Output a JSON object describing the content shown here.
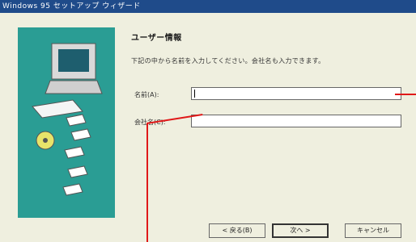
{
  "window": {
    "title": "Windows 95 セットアップ ウィザード"
  },
  "page": {
    "heading": "ユーザー情報",
    "description": "下記の中から名前を入力してください。会社名も入力できます。",
    "name_label": "名前(A):",
    "company_label": "会社名(C):",
    "name_value": "",
    "company_value": ""
  },
  "buttons": {
    "back": "< 戻る(B)",
    "next": "次へ >",
    "cancel": "キャンセル"
  },
  "colors": {
    "accent": "#e01919",
    "titlebar": "#1f4b8a",
    "illustration_bg": "#2a9d94",
    "dialog_bg": "#efefdf",
    "outer_bg": "#9fe6d2"
  },
  "icons": [
    "computer-icon",
    "cd-icon",
    "floppy-disk-icon"
  ]
}
